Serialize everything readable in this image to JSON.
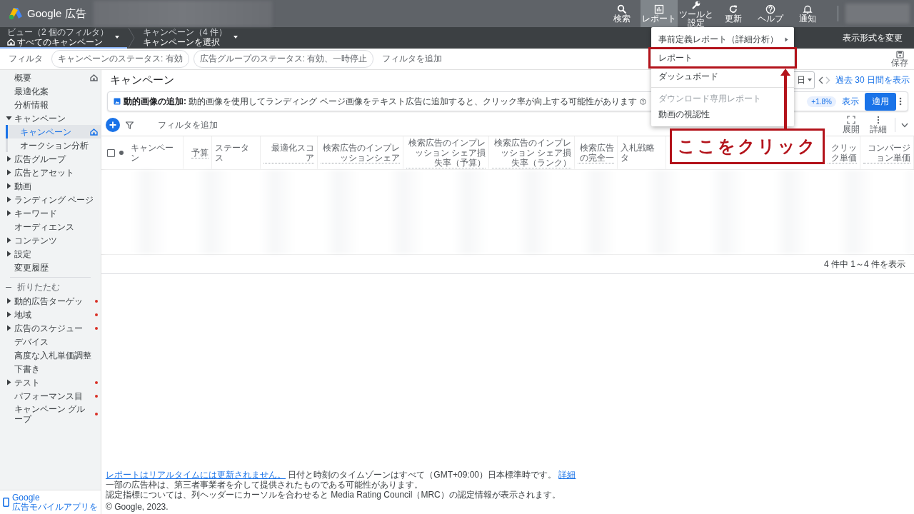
{
  "top_bar": {
    "product": "Google 広告",
    "actions": [
      {
        "label": "検索",
        "selected": false
      },
      {
        "label": "レポート",
        "selected": true
      },
      {
        "label": "ツールと設定",
        "selected": false
      },
      {
        "label": "更新",
        "selected": false
      },
      {
        "label": "ヘルプ",
        "selected": false
      },
      {
        "label": "通知",
        "selected": false
      }
    ]
  },
  "nav_bar": {
    "pickers": [
      {
        "caption": "ビュー（2 個のフィルタ）",
        "value": "すべてのキャンペーン",
        "selected": true
      },
      {
        "caption": "キャンペーン（4 件）",
        "value": "キャンペーンを選択",
        "selected": false
      }
    ],
    "change_view": "表示形式を変更"
  },
  "filter_bar": {
    "label": "フィルタ",
    "chips": [
      "キャンペーンのステータス: 有効",
      "広告グループのステータス: 有効、一時停止"
    ],
    "add_filter": "フィルタを追加",
    "save": "保存"
  },
  "sidebar": {
    "items": [
      {
        "label": "概要",
        "kind": "link",
        "selected": false,
        "home": true,
        "alert": false
      },
      {
        "label": "最適化案",
        "kind": "link",
        "selected": false,
        "home": false,
        "alert": false
      },
      {
        "label": "分析情報",
        "kind": "link",
        "selected": false,
        "home": false,
        "alert": false
      },
      {
        "label": "キャンペーン",
        "kind": "group",
        "expanded": true,
        "selected": false,
        "home": false,
        "alert": false,
        "children": [
          {
            "label": "キャンペーン",
            "kind": "link",
            "selected": true,
            "home": true,
            "alert": false
          },
          {
            "label": "オークション分析",
            "kind": "link",
            "selected": false,
            "home": false,
            "alert": false
          }
        ]
      },
      {
        "label": "広告グループ",
        "kind": "group",
        "expanded": false,
        "selected": false,
        "home": false,
        "alert": false
      },
      {
        "label": "広告とアセット",
        "kind": "group",
        "expanded": false,
        "selected": false,
        "home": false,
        "alert": false
      },
      {
        "label": "動画",
        "kind": "group",
        "expanded": false,
        "selected": false,
        "home": false,
        "alert": false
      },
      {
        "label": "ランディング ページ",
        "kind": "group",
        "expanded": false,
        "selected": false,
        "home": false,
        "alert": false
      },
      {
        "label": "キーワード",
        "kind": "group",
        "expanded": false,
        "selected": false,
        "home": false,
        "alert": false
      },
      {
        "label": "オーディエンス",
        "kind": "link",
        "selected": false,
        "home": false,
        "alert": false
      },
      {
        "label": "コンテンツ",
        "kind": "group",
        "expanded": false,
        "selected": false,
        "home": false,
        "alert": false
      },
      {
        "label": "設定",
        "kind": "group",
        "expanded": false,
        "selected": false,
        "home": false,
        "alert": false
      },
      {
        "label": "変更履歴",
        "kind": "link",
        "selected": false,
        "home": false,
        "alert": false
      }
    ],
    "collapse": "折りたたむ",
    "more_items": [
      {
        "label": "動的広告ターゲッ",
        "kind": "group",
        "expanded": false,
        "selected": false,
        "home": false,
        "alert": true
      },
      {
        "label": "地域",
        "kind": "group",
        "expanded": false,
        "selected": false,
        "home": false,
        "alert": true
      },
      {
        "label": "広告のスケジュー",
        "kind": "group",
        "expanded": false,
        "selected": false,
        "home": false,
        "alert": true
      },
      {
        "label": "デバイス",
        "kind": "link",
        "selected": false,
        "home": false,
        "alert": false
      },
      {
        "label": "高度な入札単価調整",
        "kind": "link",
        "selected": false,
        "home": false,
        "alert": false
      },
      {
        "label": "下書き",
        "kind": "link",
        "selected": false,
        "home": false,
        "alert": false
      },
      {
        "label": "テスト",
        "kind": "group",
        "expanded": false,
        "selected": false,
        "home": false,
        "alert": true
      },
      {
        "label": "パフォーマンス目",
        "kind": "link",
        "selected": false,
        "home": false,
        "alert": true
      },
      {
        "label": "キャンペーン グループ",
        "kind": "link",
        "selected": false,
        "home": false,
        "alert": true
      }
    ],
    "mobile_app": {
      "title": "Google",
      "subtitle": "広告モバイルアプリを"
    }
  },
  "campaigns": {
    "title": "キャンペーン",
    "date_range": {
      "value": "日",
      "link": "過去 30 日間を表示"
    },
    "banner": {
      "text": "**動的画像の追加:** 動的画像を使用してランディング ページ画像をテキスト広告に追加すると、クリック率が向上する可能性があります",
      "uplift": "+1.8%",
      "view": "表示",
      "apply": "適用"
    },
    "toolbar": {
      "add_filter": "フィルタを追加",
      "tools": [
        "展開",
        "詳細"
      ]
    },
    "table": {
      "columns": [
        {
          "label": "キャンペーン",
          "kind": "attribute"
        },
        {
          "label": "予算",
          "kind": "metric"
        },
        {
          "label": "ステータス",
          "kind": "attribute"
        },
        {
          "label": "最適化スコア",
          "kind": "metric"
        },
        {
          "label": "検索広告のインプレッションシェア",
          "kind": "metric"
        },
        {
          "label": "検索広告のインプレッション シェア損失率（予算）",
          "kind": "metric"
        },
        {
          "label": "検索広告のインプレッション シェア損失率（ランク）",
          "kind": "metric"
        },
        {
          "label": "検索広告の完全一",
          "kind": "metric"
        },
        {
          "label": "入札戦略タ",
          "kind": "attribute"
        },
        {
          "label": "クリック単価",
          "kind": "metric"
        },
        {
          "label": "コンバージョン単価",
          "kind": "metric"
        }
      ],
      "select_all": {
        "checked": false
      },
      "summary": "4 件中 1～4 件を表示"
    }
  },
  "footer": {
    "realtime_link": "レポートはリアルタイムには更新されません。",
    "timezone": "日付と時刻のタイムゾーンはすべて（GMT+09:00）日本標準時です。",
    "details_link": "詳細",
    "notes": [
      "一部の広告枠は、第三者事業者を介して提供されたものである可能性があります。",
      "認定指標については、列ヘッダーにカーソルを合わせると Media Rating Council（MRC）の認定情報が表示されます。"
    ],
    "copyright": "© Google, 2023."
  },
  "reports_menu": {
    "items": [
      {
        "label": "事前定義レポート（詳細分析）",
        "kind": "submenu",
        "disabled": false,
        "highlighted": false
      },
      {
        "label": "レポート",
        "kind": "item",
        "disabled": false,
        "highlighted": true
      },
      {
        "label": "ダッシュボード",
        "kind": "item",
        "disabled": false,
        "highlighted": false
      },
      {
        "kind": "divider"
      },
      {
        "label": "ダウンロード専用レポート",
        "kind": "item",
        "disabled": true,
        "highlighted": false
      },
      {
        "label": "動画の視認性",
        "kind": "item",
        "disabled": false,
        "highlighted": false
      }
    ]
  },
  "annotation": {
    "callout": "ここをクリック"
  }
}
